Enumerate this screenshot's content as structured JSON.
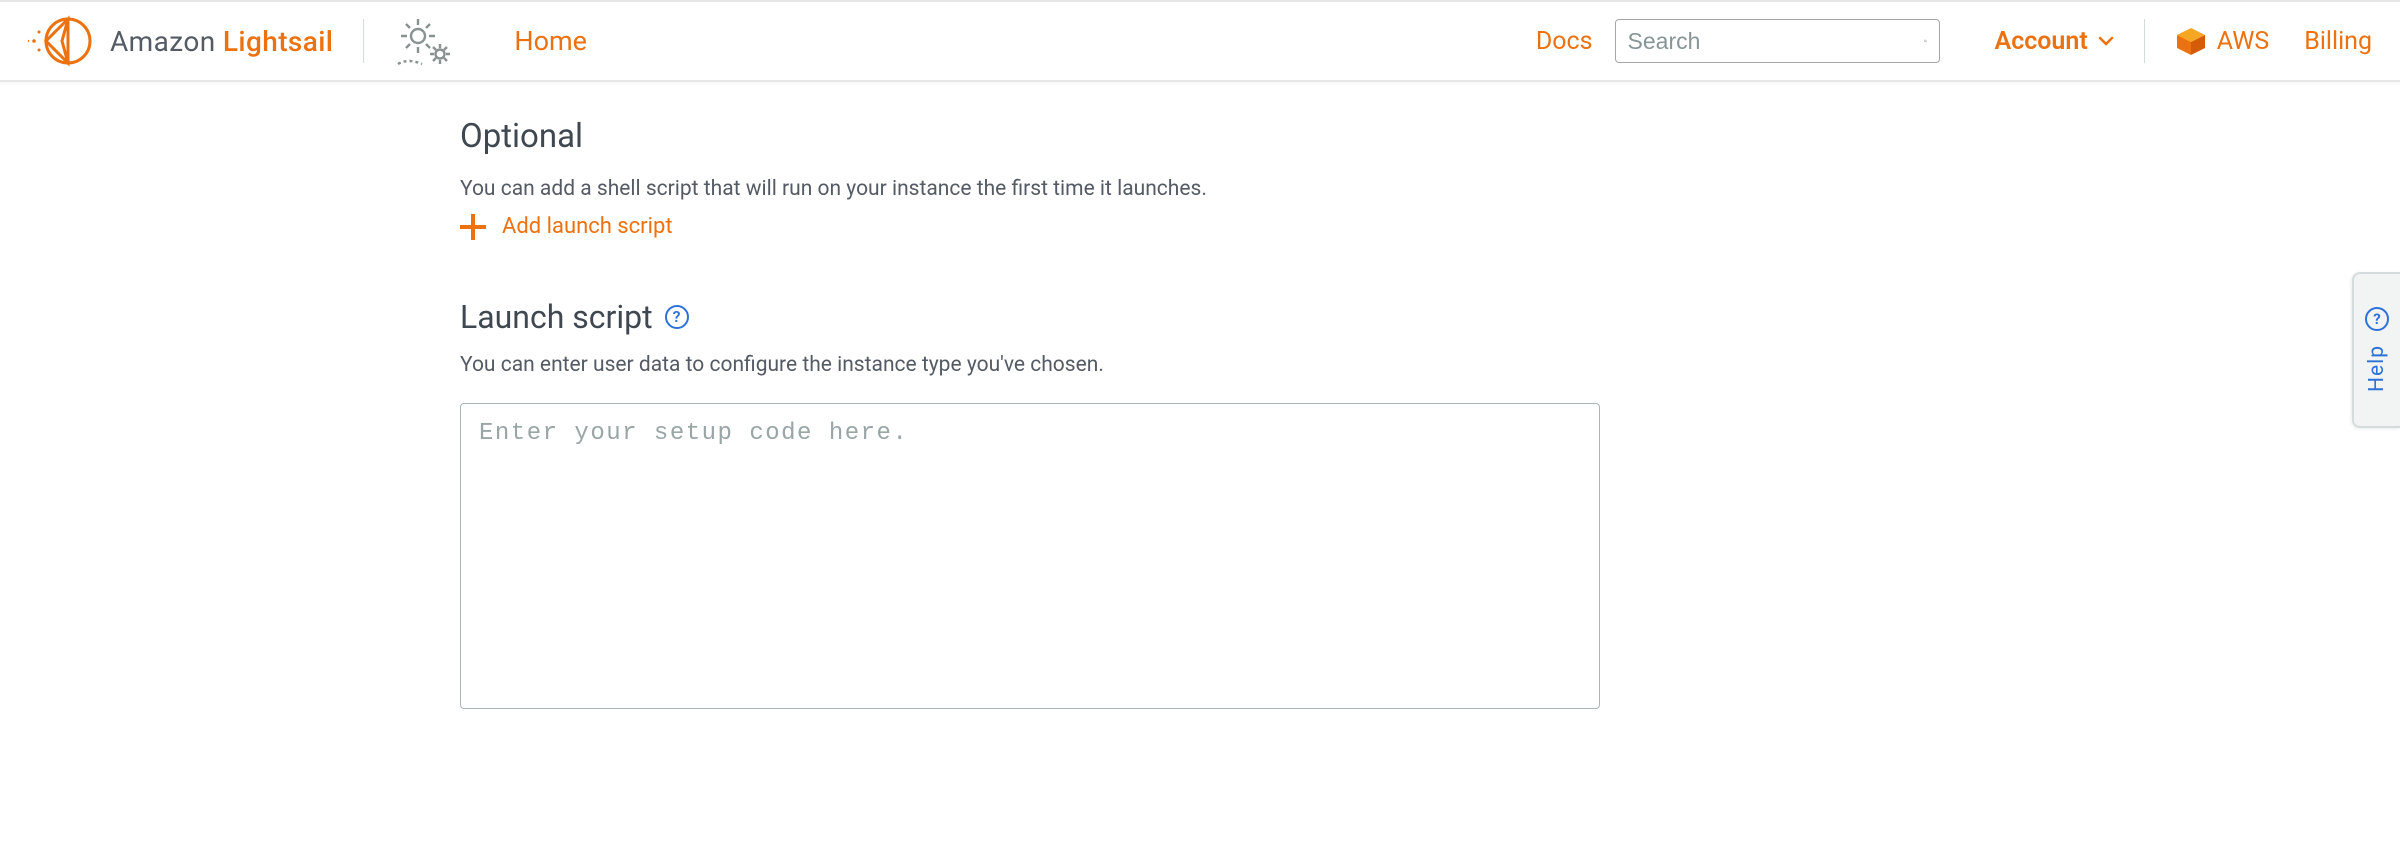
{
  "header": {
    "brand_prefix": "Amazon ",
    "brand_suffix": "Lightsail",
    "home": "Home",
    "docs": "Docs",
    "search_placeholder": "Search",
    "account": "Account",
    "aws": "AWS",
    "billing": "Billing"
  },
  "optional": {
    "title": "Optional",
    "description": "You can add a shell script that will run on your instance the first time it launches.",
    "add_label": "Add launch script"
  },
  "launch_script": {
    "title": "Launch script",
    "description": "You can enter user data to configure the instance type you've chosen.",
    "placeholder": "Enter your setup code here."
  },
  "help_tab": {
    "label": "Help"
  },
  "colors": {
    "accent": "#ec7211",
    "link_blue": "#2d72d9",
    "text_muted": "#545b64"
  }
}
